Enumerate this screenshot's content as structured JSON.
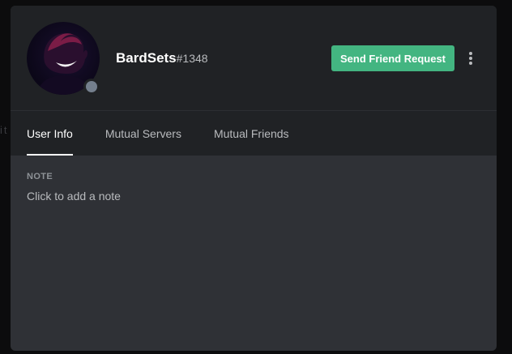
{
  "background": {
    "hint_text": "it"
  },
  "profile": {
    "username": "BardSets",
    "discriminator": "#1348",
    "status": "offline",
    "status_color": "#747f8d",
    "avatar_icon": "avatar-image"
  },
  "actions": {
    "friend_request_label": "Send Friend Request",
    "friend_request_color": "#43b581",
    "more_icon": "more-vertical-icon"
  },
  "tabs": [
    {
      "label": "User Info",
      "active": true
    },
    {
      "label": "Mutual Servers",
      "active": false
    },
    {
      "label": "Mutual Friends",
      "active": false
    }
  ],
  "note": {
    "label": "NOTE",
    "placeholder": "Click to add a note"
  }
}
